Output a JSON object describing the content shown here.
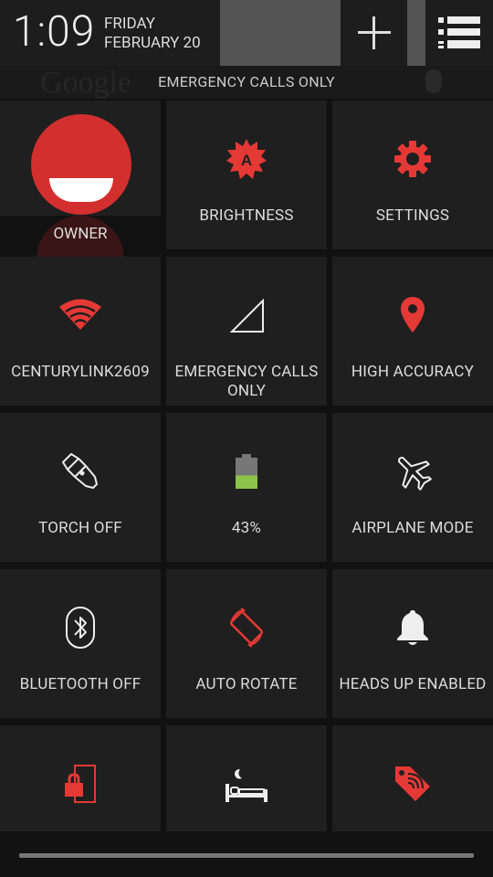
{
  "header": {
    "time": "1:09",
    "day": "FRIDAY",
    "date": "FEBRUARY 20"
  },
  "carrier": {
    "text": "EMERGENCY CALLS ONLY",
    "background_ghost": "Google"
  },
  "tiles": [
    {
      "label": "OWNER",
      "icon": "user-avatar-icon"
    },
    {
      "label": "BRIGHTNESS",
      "icon": "auto-brightness-icon"
    },
    {
      "label": "SETTINGS",
      "icon": "gear-icon"
    },
    {
      "label": "CENTURYLINK2609",
      "icon": "wifi-icon"
    },
    {
      "label": "EMERGENCY CALLS ONLY",
      "icon": "cell-signal-icon"
    },
    {
      "label": "HIGH ACCURACY",
      "icon": "location-pin-icon"
    },
    {
      "label": "TORCH OFF",
      "icon": "flashlight-icon"
    },
    {
      "label": "43%",
      "icon": "battery-icon",
      "battery_level": 0.43
    },
    {
      "label": "AIRPLANE MODE",
      "icon": "airplane-icon"
    },
    {
      "label": "BLUETOOTH OFF",
      "icon": "bluetooth-icon"
    },
    {
      "label": "AUTO ROTATE",
      "icon": "rotate-icon"
    },
    {
      "label": "HEADS UP ENABLED",
      "icon": "bell-icon"
    },
    {
      "label": "",
      "icon": "lock-screen-icon"
    },
    {
      "label": "",
      "icon": "sleep-icon"
    },
    {
      "label": "",
      "icon": "tag-nfc-icon"
    }
  ],
  "colors": {
    "accent": "#e53935",
    "tile_bg": "#1f1f1f",
    "battery_fill": "#8bc34a",
    "text": "#dddddd"
  }
}
